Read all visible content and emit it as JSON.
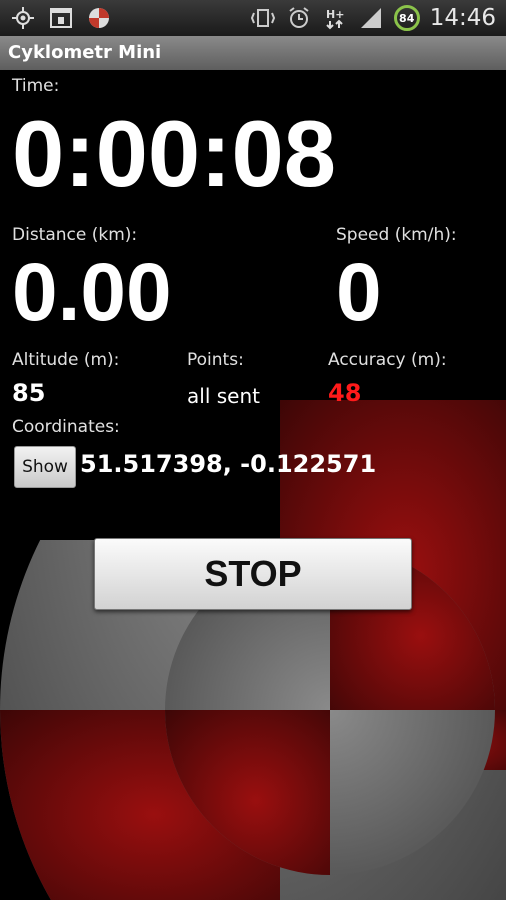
{
  "status_bar": {
    "icons_left": [
      "gps-icon",
      "photo-icon",
      "app-icon"
    ],
    "icons_right": [
      "vibrate-icon",
      "alarm-icon",
      "hplus-data-icon",
      "signal-icon",
      "battery-icon"
    ],
    "battery": "84",
    "clock": "14:46",
    "battery_color": "#8bc34a"
  },
  "app": {
    "title": "Cyklometr Mini"
  },
  "time": {
    "label": "Time:",
    "value": "0:00:08"
  },
  "distance": {
    "label": "Distance (km):",
    "value": "0.00"
  },
  "speed": {
    "label": "Speed (km/h):",
    "value": "0"
  },
  "altitude": {
    "label": "Altitude (m):",
    "value": "85"
  },
  "points": {
    "label": "Points:",
    "value": "all sent"
  },
  "accuracy": {
    "label": "Accuracy (m):",
    "value": "48",
    "color": "#ff1a1a"
  },
  "coordinates": {
    "label": "Coordinates:",
    "show_label": "Show",
    "value": "51.517398, -0.122571"
  },
  "stop_label": "STOP"
}
